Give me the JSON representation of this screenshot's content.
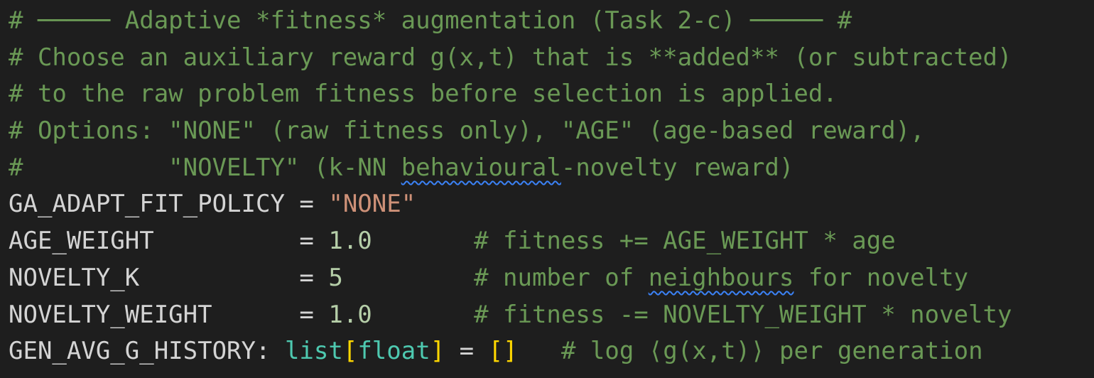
{
  "editor": {
    "language": "python",
    "theme": "dark",
    "colors": {
      "background": "#1e1e1e",
      "comment": "#6a9955",
      "identifier": "#d4d4d4",
      "string": "#ce9178",
      "number": "#b5cea8",
      "type": "#4ec9b0",
      "bracket": "#ffd700",
      "spellcheck_squiggle": "#3b82f6"
    },
    "lines": [
      {
        "tokens": [
          {
            "text": "# ───── Adaptive *fitness* augmentation (Task 2-c) ───── #",
            "kind": "comment"
          }
        ]
      },
      {
        "tokens": [
          {
            "text": "# Choose an auxiliary reward g(x,t) that is **added** (or subtracted)",
            "kind": "comment"
          }
        ]
      },
      {
        "tokens": [
          {
            "text": "# to the raw problem fitness before selection is applied.",
            "kind": "comment"
          }
        ]
      },
      {
        "tokens": [
          {
            "text": "# Options: \"NONE\" (raw fitness only), \"AGE\" (age-based reward),",
            "kind": "comment"
          }
        ]
      },
      {
        "tokens": [
          {
            "text": "#          \"NOVELTY\" (k-NN ",
            "kind": "comment"
          },
          {
            "text": "behavioural",
            "kind": "comment",
            "flag": "misspelled"
          },
          {
            "text": "-novelty reward)",
            "kind": "comment"
          }
        ]
      },
      {
        "tokens": [
          {
            "text": "GA_ADAPT_FIT_POLICY",
            "kind": "var"
          },
          {
            "text": " = ",
            "kind": "op"
          },
          {
            "text": "\"NONE\"",
            "kind": "string"
          }
        ]
      },
      {
        "tokens": [
          {
            "text": "AGE_WEIGHT",
            "kind": "var"
          },
          {
            "text": "          = ",
            "kind": "op"
          },
          {
            "text": "1.0",
            "kind": "number"
          },
          {
            "text": "       ",
            "kind": "op"
          },
          {
            "text": "# fitness += AGE_WEIGHT * age",
            "kind": "comment"
          }
        ]
      },
      {
        "tokens": [
          {
            "text": "NOVELTY_K",
            "kind": "var"
          },
          {
            "text": "           = ",
            "kind": "op"
          },
          {
            "text": "5",
            "kind": "number"
          },
          {
            "text": "         ",
            "kind": "op"
          },
          {
            "text": "# number of ",
            "kind": "comment"
          },
          {
            "text": "neighbours",
            "kind": "comment",
            "flag": "misspelled"
          },
          {
            "text": " for novelty",
            "kind": "comment"
          }
        ]
      },
      {
        "tokens": [
          {
            "text": "NOVELTY_WEIGHT",
            "kind": "var"
          },
          {
            "text": "      = ",
            "kind": "op"
          },
          {
            "text": "1.0",
            "kind": "number"
          },
          {
            "text": "       ",
            "kind": "op"
          },
          {
            "text": "# fitness -= NOVELTY_WEIGHT * novelty",
            "kind": "comment"
          }
        ]
      },
      {
        "tokens": [
          {
            "text": "GEN_AVG_G_HISTORY",
            "kind": "var"
          },
          {
            "text": ": ",
            "kind": "op"
          },
          {
            "text": "list",
            "kind": "type"
          },
          {
            "text": "[",
            "kind": "bracket"
          },
          {
            "text": "float",
            "kind": "type"
          },
          {
            "text": "]",
            "kind": "bracket"
          },
          {
            "text": " = ",
            "kind": "op"
          },
          {
            "text": "[]",
            "kind": "bracket"
          },
          {
            "text": "   ",
            "kind": "op"
          },
          {
            "text": "# log ⟨g(x,t)⟩ per generation",
            "kind": "comment"
          }
        ]
      }
    ]
  }
}
